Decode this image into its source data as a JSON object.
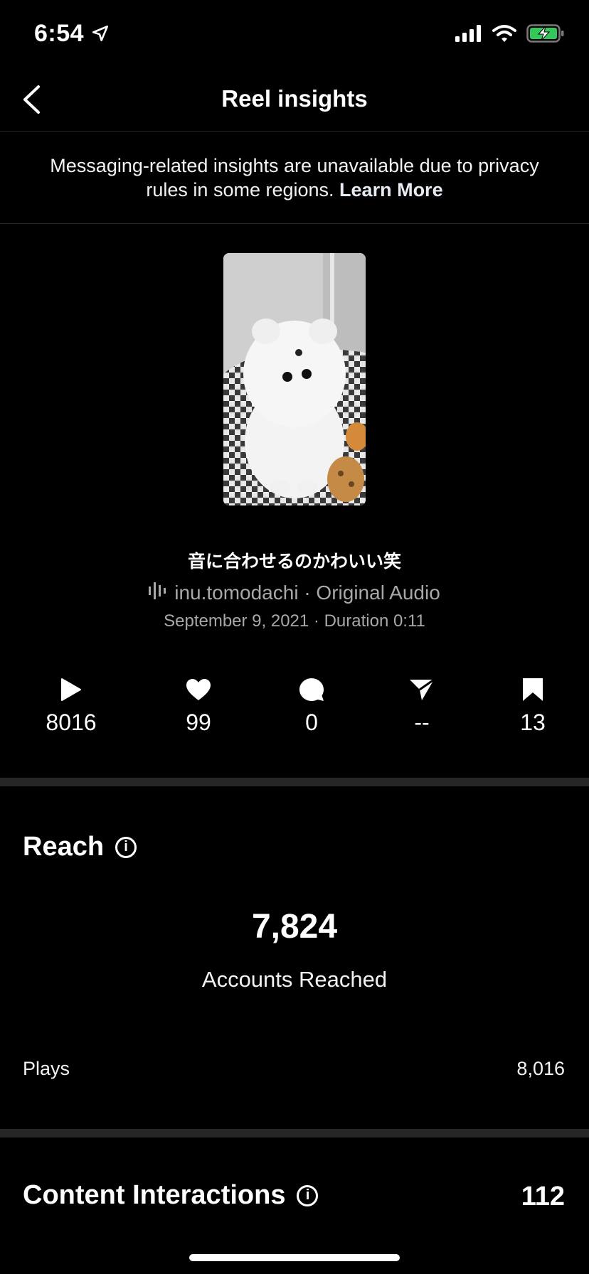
{
  "status_bar": {
    "time": "6:54"
  },
  "nav": {
    "title": "Reel insights"
  },
  "notice": {
    "text": "Messaging-related insights are unavailable due to privacy rules in some regions.",
    "link": "Learn More"
  },
  "reel": {
    "title": "音に合わせるのかわいい笑",
    "audio": "inu.tomodachi · Original Audio",
    "meta": "September 9, 2021 · Duration 0:11"
  },
  "stats": {
    "plays": "8016",
    "likes": "99",
    "comments": "0",
    "shares": "--",
    "saves": "13"
  },
  "reach": {
    "heading": "Reach",
    "accounts_reached": "7,824",
    "accounts_reached_label": "Accounts Reached",
    "plays_label": "Plays",
    "plays_value": "8,016"
  },
  "content_interactions": {
    "heading": "Content Interactions",
    "value": "112"
  }
}
